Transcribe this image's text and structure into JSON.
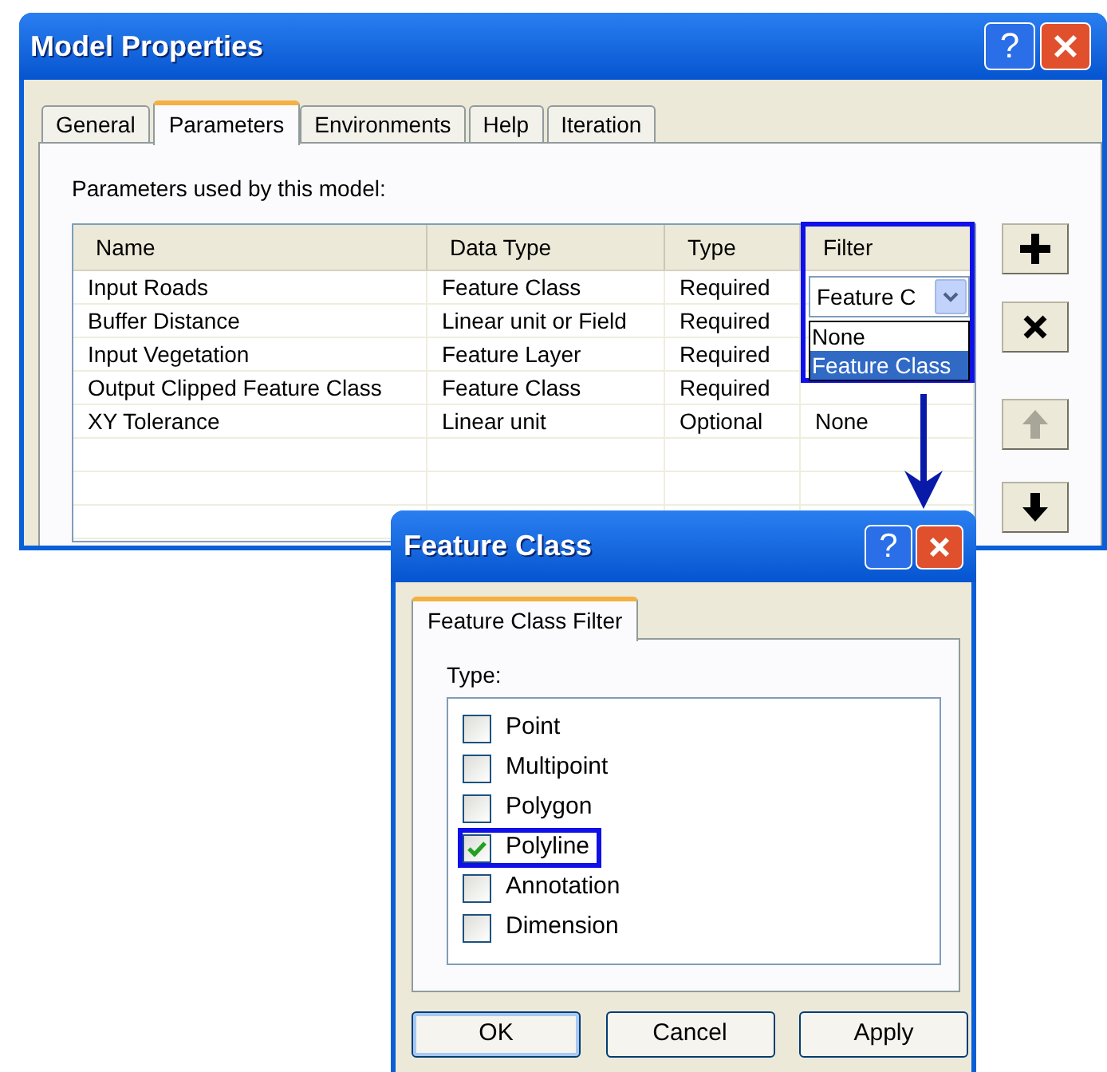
{
  "model_window": {
    "title": "Model Properties",
    "help_button": "?",
    "tabs": [
      {
        "label": "General",
        "selected": false
      },
      {
        "label": "Parameters",
        "selected": true
      },
      {
        "label": "Environments",
        "selected": false
      },
      {
        "label": "Help",
        "selected": false
      },
      {
        "label": "Iteration",
        "selected": false
      }
    ],
    "caption": "Parameters used by this model:",
    "table": {
      "columns": [
        "Name",
        "Data Type",
        "Type",
        "Filter"
      ],
      "rows": [
        {
          "name": "Input Roads",
          "data_type": "Feature Class",
          "type": "Required"
        },
        {
          "name": "Buffer Distance",
          "data_type": "Linear unit or Field",
          "type": "Required"
        },
        {
          "name": "Input Vegetation",
          "data_type": "Feature Layer",
          "type": "Required"
        },
        {
          "name": "Output Clipped Feature Class",
          "data_type": "Feature Class",
          "type": "Required"
        },
        {
          "name": "XY Tolerance",
          "data_type": "Linear unit",
          "type": "Optional",
          "filter": "None"
        }
      ]
    },
    "filter_dropdown": {
      "value": "Feature C",
      "options": [
        {
          "label": "None",
          "selected": false
        },
        {
          "label": "Feature Class",
          "selected": true
        }
      ]
    },
    "side_buttons": [
      {
        "kind": "add",
        "disabled": false
      },
      {
        "kind": "remove",
        "disabled": false
      },
      {
        "kind": "up",
        "disabled": true
      },
      {
        "kind": "down",
        "disabled": false
      }
    ]
  },
  "feature_class_window": {
    "title": "Feature Class",
    "help_button": "?",
    "tabs": [
      {
        "label": "Feature Class Filter",
        "selected": true
      }
    ],
    "type_label": "Type:",
    "types": [
      {
        "label": "Point",
        "checked": false,
        "highlighted": false
      },
      {
        "label": "Multipoint",
        "checked": false,
        "highlighted": false
      },
      {
        "label": "Polygon",
        "checked": false,
        "highlighted": false
      },
      {
        "label": "Polyline",
        "checked": true,
        "highlighted": true
      },
      {
        "label": "Annotation",
        "checked": false,
        "highlighted": false
      },
      {
        "label": "Dimension",
        "checked": false,
        "highlighted": false
      }
    ],
    "buttons": [
      {
        "label": "OK",
        "default": true
      },
      {
        "label": "Cancel",
        "default": false
      },
      {
        "label": "Apply",
        "default": false
      }
    ]
  }
}
